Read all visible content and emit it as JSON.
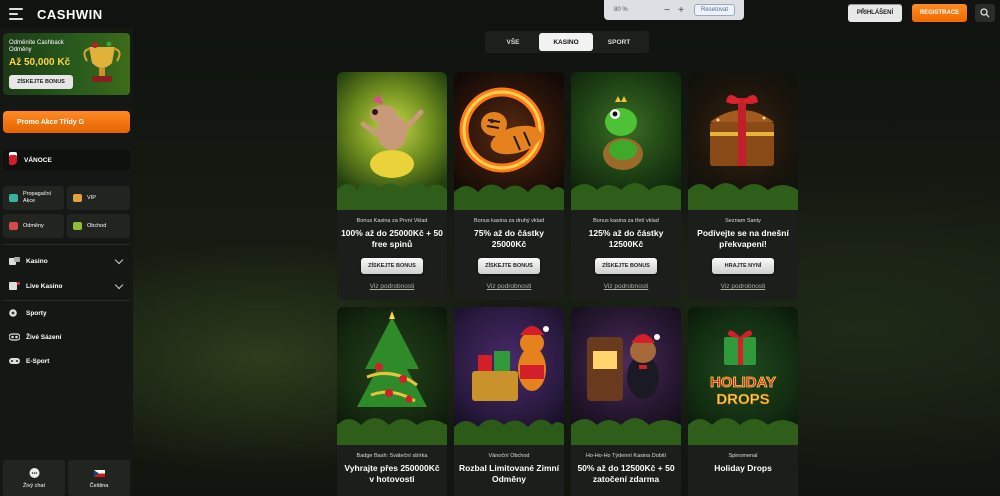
{
  "header": {
    "logo": "CASHWIN",
    "zoom": {
      "value": "80 %",
      "minus": "−",
      "plus": "+",
      "reset": "Resetovat"
    },
    "login_label": "PŘIHLÁŠENÍ",
    "register_label": "REGISTRACE"
  },
  "sidebar": {
    "promo": {
      "line1": "Odměníte Cashback Odměny",
      "amount": "Až 50,000 Kč",
      "cta": "ZÍSKEJTE BONUS"
    },
    "promo_orange": "Promo Akce Třídy G",
    "xmas": "VÁNOCE",
    "tiles": [
      {
        "label": "Propagační Akce",
        "icon": "gift-icon",
        "color": "#37b3a0"
      },
      {
        "label": "VIP",
        "icon": "crown-icon",
        "color": "#e0a23a"
      },
      {
        "label": "Odměny",
        "icon": "reward-icon",
        "color": "#d24a4a"
      },
      {
        "label": "Obchod",
        "icon": "shop-icon",
        "color": "#8fbf3a"
      }
    ],
    "nav": [
      {
        "label": "Kasino",
        "icon": "casino-icon",
        "chevron": true
      },
      {
        "label": "Live Kasino",
        "icon": "live-casino-icon",
        "chevron": true
      },
      {
        "label": "Sporty",
        "icon": "soccer-ball-icon",
        "chevron": false
      },
      {
        "label": "Živé Sázení",
        "icon": "live-bet-icon",
        "chevron": false
      },
      {
        "label": "E-Sport",
        "icon": "gamepad-icon",
        "chevron": false
      }
    ],
    "bottom": [
      {
        "label": "Živý chat",
        "icon": "chat-icon"
      },
      {
        "label": "Čeština",
        "icon": "czech-flag-icon"
      }
    ]
  },
  "tabs": [
    {
      "label": "VŠE",
      "active": false
    },
    {
      "label": "KASINO",
      "active": true
    },
    {
      "label": "SPORT",
      "active": false
    }
  ],
  "cards": [
    {
      "subtitle": "Bonus Kasina za První Vklad",
      "title": "100% až do 25000Kč + 50 free spinů",
      "button": "ZÍSKEJTE BONUS",
      "link": "Viz podrobnosti",
      "art": "hippo-dancer"
    },
    {
      "subtitle": "Bonus kasina za druhý vklad",
      "title": "75% až do částky 25000Kč",
      "button": "ZÍSKEJTE BONUS",
      "link": "Viz podrobnosti",
      "art": "tiger-fire-ring"
    },
    {
      "subtitle": "Bonus kasina za třetí vklad",
      "title": "125% až do částky 12500Kč",
      "button": "ZÍSKEJTE BONUS",
      "link": "Viz podrobnosti",
      "art": "frog-prince"
    },
    {
      "subtitle": "Seznam Santy",
      "title": "Podívejte se na dnešní překvapení!",
      "button": "HRAJTE NYNÍ",
      "link": "Viz podrobnosti",
      "art": "treasure-chest"
    },
    {
      "subtitle": "Badge Bash: Sváteční sbírka",
      "title": "Vyhrajte přes 250000Kč v hotovosti",
      "art": "christmas-tree"
    },
    {
      "subtitle": "Vánoční Obchod",
      "title": "Rozbal Limitované Zimní Odměny",
      "art": "tiger-santa"
    },
    {
      "subtitle": "Ho-Ho-Ho Týdenní Kasina Dobití",
      "title": "50% až do 12500Kč + 50 zatočení zdarma",
      "art": "monkey-slot"
    },
    {
      "subtitle": "Spinomenal",
      "title": "Holiday Drops",
      "art": "holiday-drops",
      "art_text": [
        "HOLIDAY",
        "DROPS"
      ]
    }
  ]
}
